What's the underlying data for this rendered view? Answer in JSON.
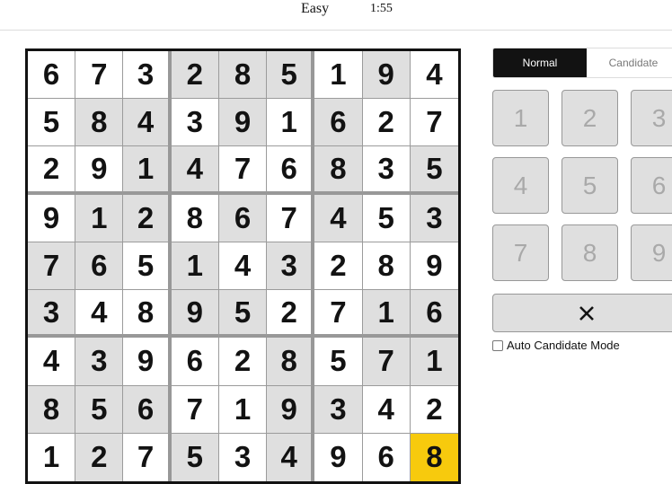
{
  "header": {
    "difficulty": "Easy",
    "timer": "1:55"
  },
  "board": {
    "rows": [
      [
        6,
        7,
        3,
        2,
        8,
        5,
        1,
        9,
        4
      ],
      [
        5,
        8,
        4,
        3,
        9,
        1,
        6,
        2,
        7
      ],
      [
        2,
        9,
        1,
        4,
        7,
        6,
        8,
        3,
        5
      ],
      [
        9,
        1,
        2,
        8,
        6,
        7,
        4,
        5,
        3
      ],
      [
        7,
        6,
        5,
        1,
        4,
        3,
        2,
        8,
        9
      ],
      [
        3,
        4,
        8,
        9,
        5,
        2,
        7,
        1,
        6
      ],
      [
        4,
        3,
        9,
        6,
        2,
        8,
        5,
        7,
        1
      ],
      [
        8,
        5,
        6,
        7,
        1,
        9,
        3,
        4,
        2
      ],
      [
        1,
        2,
        7,
        5,
        3,
        4,
        9,
        6,
        8
      ]
    ],
    "shading": [
      [
        0,
        0,
        0,
        1,
        1,
        1,
        0,
        1,
        0
      ],
      [
        0,
        1,
        1,
        0,
        1,
        0,
        1,
        0,
        0
      ],
      [
        0,
        0,
        1,
        1,
        0,
        0,
        1,
        0,
        1
      ],
      [
        0,
        1,
        1,
        0,
        1,
        0,
        1,
        0,
        1
      ],
      [
        1,
        1,
        0,
        1,
        0,
        1,
        0,
        0,
        0
      ],
      [
        1,
        0,
        0,
        1,
        1,
        0,
        0,
        1,
        1
      ],
      [
        0,
        1,
        0,
        0,
        0,
        1,
        0,
        1,
        1
      ],
      [
        1,
        1,
        1,
        0,
        0,
        1,
        1,
        0,
        0
      ],
      [
        0,
        1,
        0,
        1,
        0,
        1,
        0,
        0,
        0
      ]
    ],
    "selected_cell": {
      "row": 9,
      "col": 9
    },
    "colors": {
      "selected": "#f7ca0d",
      "shaded": "#dfdfdf",
      "cell": "#ffffff",
      "border": "#121212"
    }
  },
  "panel": {
    "modes": [
      {
        "label": "Normal",
        "active": true
      },
      {
        "label": "Candidate",
        "active": false
      }
    ],
    "numbers": [
      "1",
      "2",
      "3",
      "4",
      "5",
      "6",
      "7",
      "8",
      "9"
    ],
    "erase_icon": "close-x-icon",
    "auto_candidate_label": "Auto Candidate Mode",
    "auto_candidate_checked": false
  }
}
